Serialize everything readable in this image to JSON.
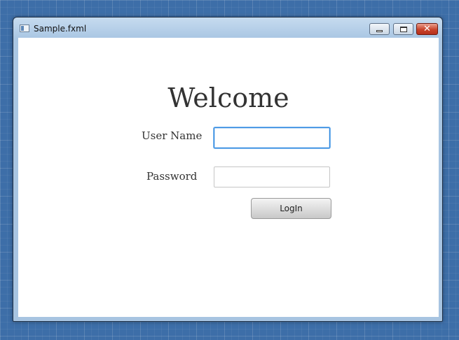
{
  "window": {
    "title": "Sample.fxml",
    "app_icon": "window-app-icon",
    "controls": {
      "minimize_icon": "minimize-icon",
      "maximize_icon": "maximize-icon",
      "close_icon": "close-icon",
      "close_glyph": "✕"
    }
  },
  "form": {
    "heading": "Welcome",
    "username_label": "User Name",
    "username_value": "",
    "password_label": "Password",
    "password_value": "",
    "login_label": "LogIn"
  },
  "colors": {
    "desktop": "#3d6ea8",
    "focus_border": "#2d87e0",
    "close_button": "#c9432a"
  }
}
